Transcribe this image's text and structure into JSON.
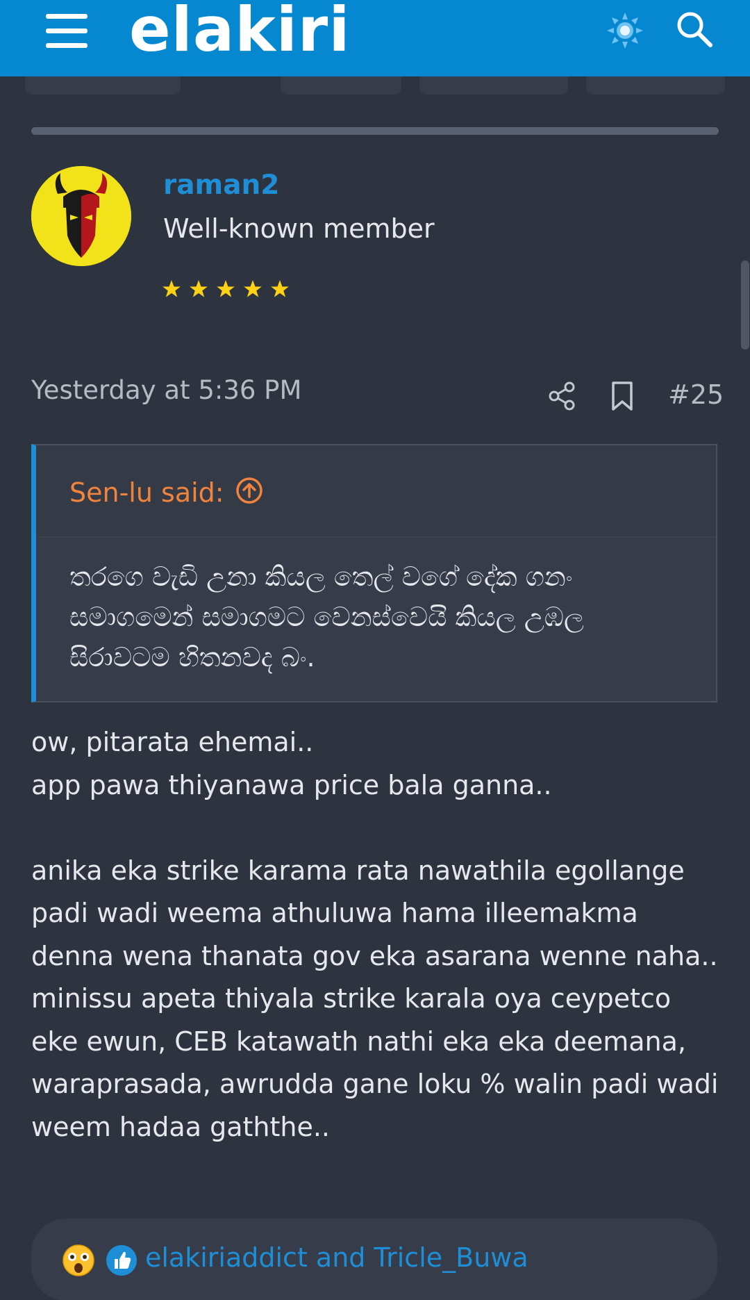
{
  "header": {
    "logo_text": "elakiri",
    "brand_color": "#0688d1"
  },
  "post": {
    "username": "raman2",
    "user_title": "Well-known member",
    "star_count": 5,
    "timestamp": "Yesterday at 5:36 PM",
    "post_number": "#25",
    "quote": {
      "author_label": "Sen-lu said:",
      "text": "තරගෙ වැඩි උනා කියල තෙල් වගේ දේක ගනං සමාගමෙන් සමාගමට වෙනස්වෙයි කියල උඹල සිරාවටම හිතනවද බං."
    },
    "body_lines": [
      "ow, pitarata ehemai..",
      "app pawa thiyanawa price bala ganna..",
      "",
      "anika eka strike karama rata nawathila egollange padi wadi weema athuluwa hama illeemakma denna wena thanata gov eka asarana wenne naha..",
      "minissu apeta thiyala strike karala oya ceypetco eke ewun, CEB katawath nathi eka eka deemana, waraprasada, awrudda gane loku % walin padi wadi weem hadaa gaththe.."
    ],
    "reactions": {
      "icons": [
        "wow-emoji-icon",
        "like-thumb-icon"
      ],
      "users_text": "elakiriaddict and Tricle_Buwa"
    }
  },
  "colors": {
    "background": "#2e3340",
    "link": "#1e8fd6",
    "quote_author": "#f0843c",
    "star": "#fcd116"
  }
}
